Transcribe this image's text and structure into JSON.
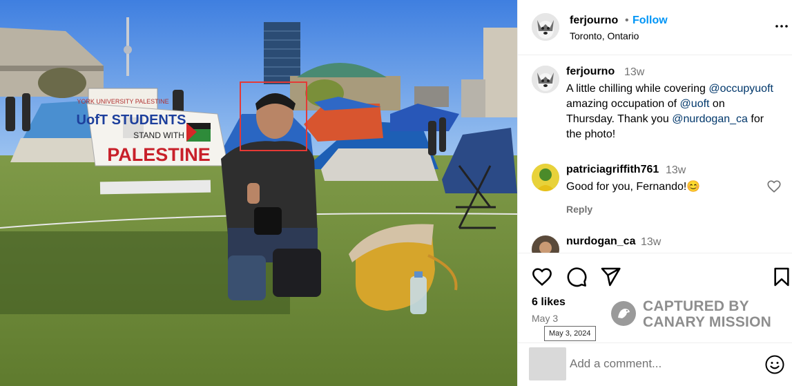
{
  "post": {
    "username": "ferjourno",
    "follow_label": "Follow",
    "separator": "•",
    "location": "Toronto, Ontario",
    "more_icon": "more-horizontal-icon"
  },
  "photo": {
    "banner_top_text": "YORK UNIVERSITY PALESTINE",
    "banner_main_line1": "UofT STUDENTS",
    "banner_main_line2": "STAND WITH",
    "banner_main_line3": "PALESTINE"
  },
  "caption": {
    "username": "ferjourno",
    "time": "13w",
    "text_parts": [
      {
        "text": "A little chilling while covering ",
        "mention": false
      },
      {
        "text": "@occupyuoft",
        "mention": true
      },
      {
        "text": " amazing occupation of ",
        "mention": false
      },
      {
        "text": "@uoft",
        "mention": true
      },
      {
        "text": " on Thursday. Thank you ",
        "mention": false
      },
      {
        "text": "@nurdogan_ca",
        "mention": true
      },
      {
        "text": " for the photo!",
        "mention": false
      }
    ]
  },
  "comments": [
    {
      "username": "patriciagriffith761",
      "time": "13w",
      "text": "Good for you, Fernando!😊",
      "reply_label": "Reply"
    },
    {
      "username": "nurdogan_ca",
      "time": "13w",
      "text": ""
    }
  ],
  "actions": {
    "like_icon": "heart-icon",
    "comment_icon": "comment-icon",
    "share_icon": "send-icon",
    "save_icon": "bookmark-icon"
  },
  "likes": "6 likes",
  "date": "May 3",
  "date_tooltip": "May 3, 2024",
  "watermark": {
    "line1": "CAPTURED BY",
    "line2": "CANARY MISSION"
  },
  "comment_input": {
    "placeholder": "Add a comment..."
  },
  "colors": {
    "follow": "#0095f6",
    "mention": "#00376b",
    "secondary_text": "#737373",
    "highlight_box": "#e53935"
  }
}
